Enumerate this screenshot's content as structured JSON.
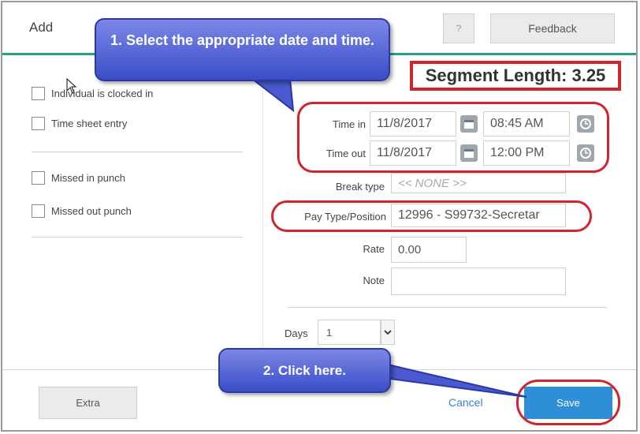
{
  "header": {
    "title": "Add",
    "help_label": "?",
    "feedback_label": "Feedback"
  },
  "left_panel": {
    "checkboxes_group1": [
      {
        "label": "Individual is clocked in"
      },
      {
        "label": "Time sheet entry"
      }
    ],
    "checkboxes_group2": [
      {
        "label": "Missed in punch"
      },
      {
        "label": "Missed out punch"
      }
    ]
  },
  "segment": {
    "text": "Segment Length: 3.25"
  },
  "form": {
    "time_in": {
      "label": "Time in",
      "date": "11/8/2017",
      "time": "08:45 AM"
    },
    "time_out": {
      "label": "Time out",
      "date": "11/8/2017",
      "time": "12:00 PM"
    },
    "break_type": {
      "label": "Break type",
      "value": "<< NONE >>"
    },
    "pay_type": {
      "label": "Pay Type/Position",
      "value": "12996 - S99732-Secretar"
    },
    "rate": {
      "label": "Rate",
      "value": "0.00"
    },
    "note": {
      "label": "Note",
      "value": ""
    },
    "days": {
      "label": "Days",
      "value": "1"
    }
  },
  "footer": {
    "extra_label": "Extra",
    "cancel_label": "Cancel",
    "save_label": "Save"
  },
  "callouts": {
    "step1": "1. Select the appropriate date and time.",
    "step2": "2. Click here."
  },
  "colors": {
    "accent_rule": "#2c9f86",
    "highlight": "#d0242f",
    "save_button": "#2f8ed8",
    "callout": "#3b4cc8"
  }
}
